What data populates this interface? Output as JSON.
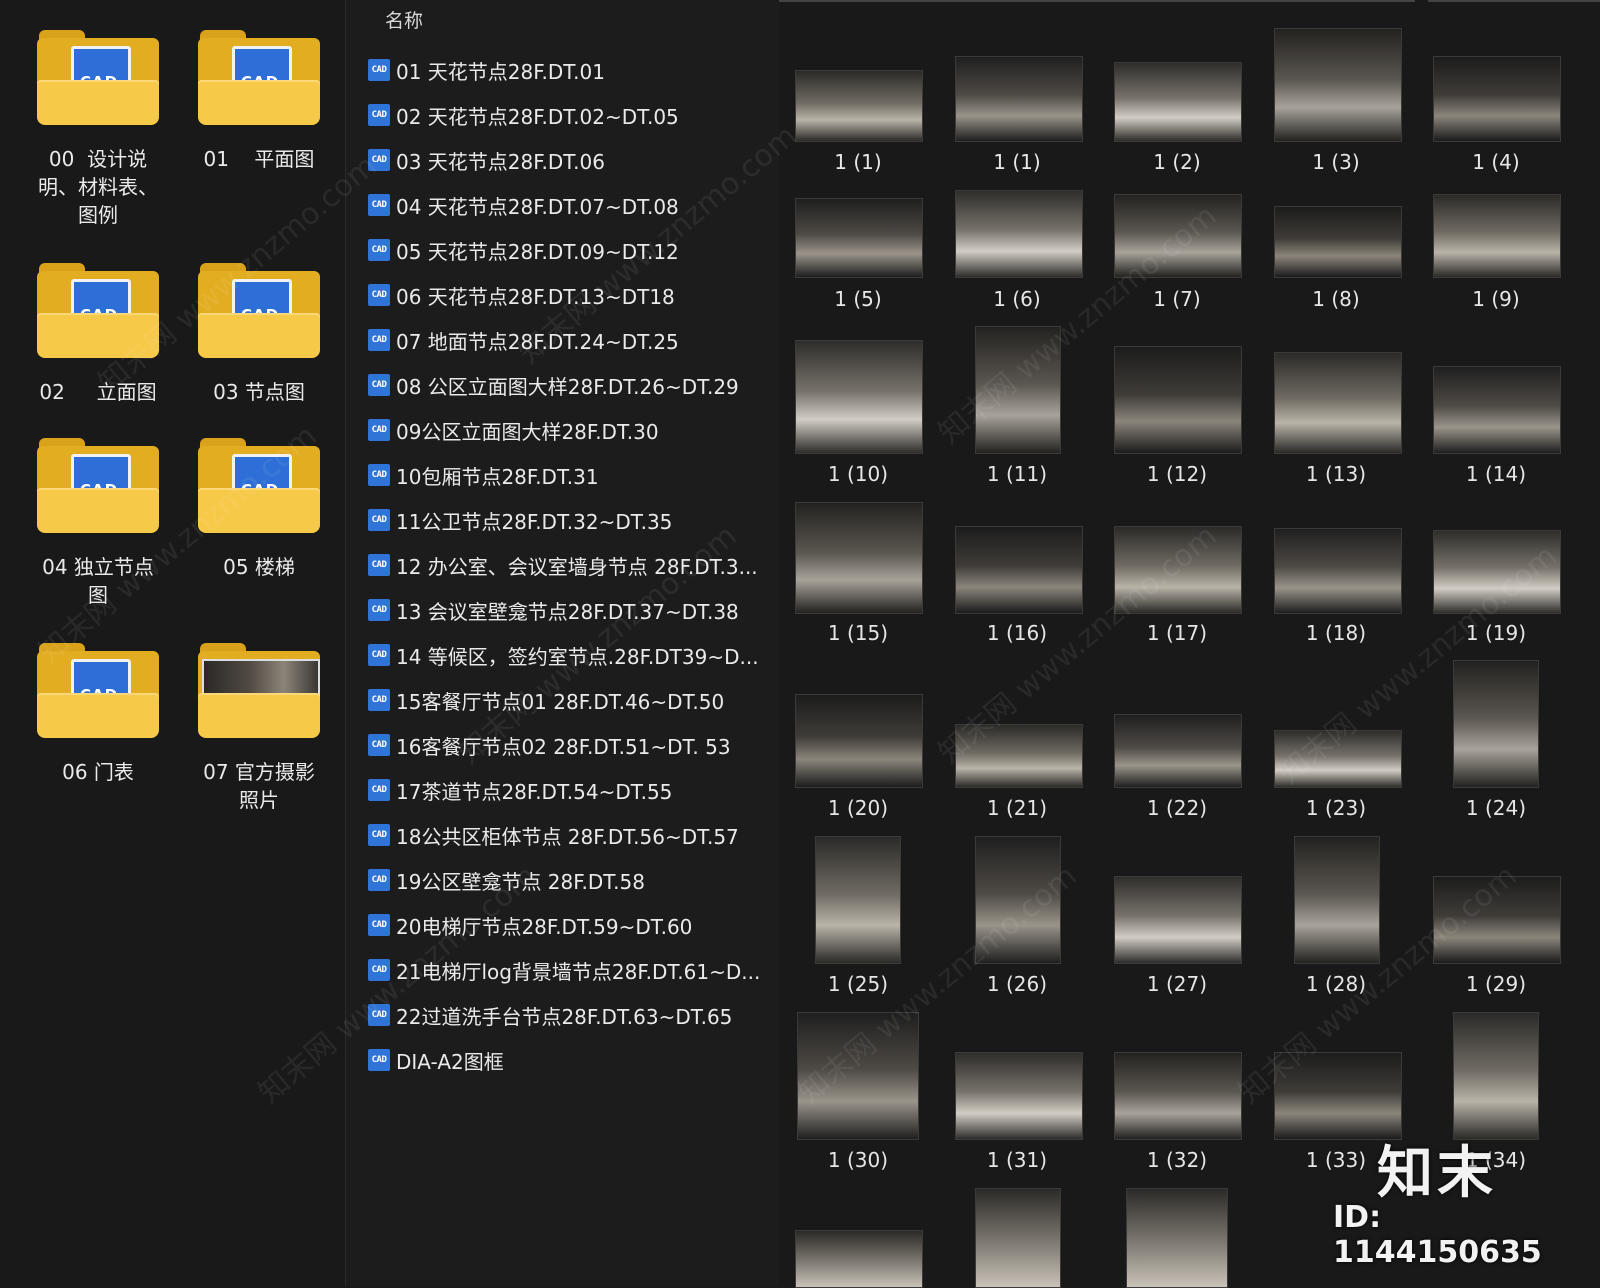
{
  "column_header": "名称",
  "folders": [
    {
      "label": "00  设计说\n明、材料表、\n图例",
      "icon": "folder-cad-icon"
    },
    {
      "label": "01    平面图",
      "icon": "folder-cad-icon"
    },
    {
      "label": "02     立面图",
      "icon": "folder-cad-icon"
    },
    {
      "label": "03 节点图",
      "icon": "folder-cad-icon"
    },
    {
      "label": "04 独立节点\n图",
      "icon": "folder-cad-icon"
    },
    {
      "label": "05 楼梯",
      "icon": "folder-cad-icon"
    },
    {
      "label": "06 门表",
      "icon": "folder-cad-icon"
    },
    {
      "label": "07 官方摄影\n照片",
      "icon": "folder-photo-icon"
    }
  ],
  "cad_badge": "CAD",
  "files": [
    "01 天花节点28F.DT.01",
    "02 天花节点28F.DT.02~DT.05",
    "03 天花节点28F.DT.06",
    "04 天花节点28F.DT.07~DT.08",
    "05 天花节点28F.DT.09~DT.12",
    "06 天花节点28F.DT.13~DT18",
    "07 地面节点28F.DT.24~DT.25",
    "08 公区立面图大样28F.DT.26~DT.29",
    "09公区立面图大样28F.DT.30",
    "10包厢节点28F.DT.31",
    "11公卫节点28F.DT.32~DT.35",
    "12 办公室、会议室墙身节点 28F.DT.3...",
    "13  会议室壁龛节点28F.DT.37~DT.38",
    "14 等候区，签约室节点.28F.DT39~D...",
    "15客餐厅节点01 28F.DT.46~DT.50",
    "16客餐厅节点02 28F.DT.51~DT. 53",
    "17茶道节点28F.DT.54~DT.55",
    "18公共区柜体节点 28F.DT.56~DT.57",
    "19公区壁龛节点 28F.DT.58",
    "20电梯厅节点28F.DT.59~DT.60",
    "21电梯厅log背景墙节点28F.DT.61~D...",
    "22过道洗手台节点28F.DT.63~DT.65",
    "DIA-A2图框"
  ],
  "thumbnails": [
    "1 (1)",
    "1 (1)",
    "1 (2)",
    "1 (3)",
    "1 (4)",
    "1 (5)",
    "1 (6)",
    "1 (7)",
    "1 (8)",
    "1 (9)",
    "1 (10)",
    "1 (11)",
    "1 (12)",
    "1 (13)",
    "1 (14)",
    "1 (15)",
    "1 (16)",
    "1 (17)",
    "1 (18)",
    "1 (19)",
    "1 (20)",
    "1 (21)",
    "1 (22)",
    "1 (23)",
    "1 (24)",
    "1 (25)",
    "1 (26)",
    "1 (27)",
    "1 (28)",
    "1 (29)",
    "1 (30)",
    "1 (31)",
    "1 (32)",
    "1 (33)",
    "1 (34)"
  ],
  "logo": "知末",
  "image_id": "ID: 1144150635",
  "watermark": "知末网 www.znzmo.com",
  "colors": {
    "background": "#191919",
    "folder": "#f7c948",
    "cad_blue": "#2f74d6"
  }
}
